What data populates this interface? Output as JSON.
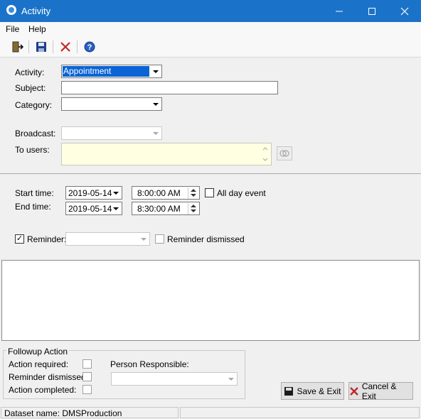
{
  "window": {
    "title": "Activity"
  },
  "menu": {
    "file": "File",
    "help": "Help"
  },
  "form": {
    "activity_label": "Activity:",
    "activity_value": "Appointment",
    "subject_label": "Subject:",
    "subject_value": "",
    "category_label": "Category:",
    "category_value": "",
    "broadcast_label": "Broadcast:",
    "to_users_label": "To users:",
    "start_time_label": "Start time:",
    "start_date": "2019-05-14",
    "start_time": "8:00:00 AM",
    "end_time_label": "End time:",
    "end_date": "2019-05-14",
    "end_time": "8:30:00 AM",
    "all_day_label": "All day event",
    "reminder_label": "Reminder:",
    "reminder_dismissed_label": "Reminder dismissed"
  },
  "followup": {
    "legend": "Followup Action",
    "action_required_label": "Action required:",
    "reminder_dismissed_label": "Reminder dismissed:",
    "action_completed_label": "Action completed:",
    "person_responsible_label": "Person Responsible:"
  },
  "buttons": {
    "save_exit": "Save & Exit",
    "cancel_exit": "Cancel & Exit"
  },
  "status": {
    "dataset": "Dataset name:  DMSProduction"
  }
}
